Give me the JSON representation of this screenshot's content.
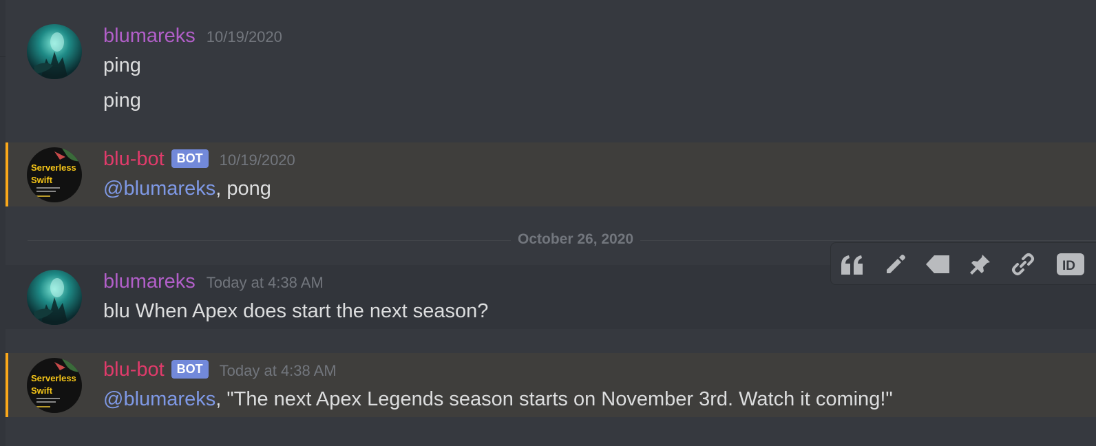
{
  "messages": [
    {
      "username": "blumareks",
      "timestamp": "10/19/2020",
      "lines": [
        "ping",
        "ping"
      ]
    },
    {
      "username": "blu-bot",
      "bot_tag": "BOT",
      "timestamp": "10/19/2020",
      "mention": "@blumareks",
      "text": ", pong"
    },
    {
      "username": "blumareks",
      "timestamp": "Today at 4:38 AM",
      "text": "blu When Apex does start the next season?"
    },
    {
      "username": "blu-bot",
      "bot_tag": "BOT",
      "timestamp": "Today at 4:38 AM",
      "mention": "@blumareks",
      "text": ", \"The next Apex Legends season starts on November 3rd. Watch it coming!\""
    }
  ],
  "divider": {
    "label": "October 26, 2020"
  },
  "avatars": {
    "bot": {
      "line1": "Serverless",
      "line2": "Swift"
    }
  },
  "toolbar": {
    "id_label": "ID",
    "icons": [
      "quote-icon",
      "edit-pencil-icon",
      "tag-icon",
      "pin-icon",
      "link-icon",
      "copy-id-icon"
    ]
  },
  "colors": {
    "background": "#36393f",
    "user_name": "#b25fc9",
    "bot_name": "#e13b6b",
    "mention": "#7f99e6",
    "bot_tag": "#7289da",
    "mention_highlight_bar": "#faa81a"
  }
}
